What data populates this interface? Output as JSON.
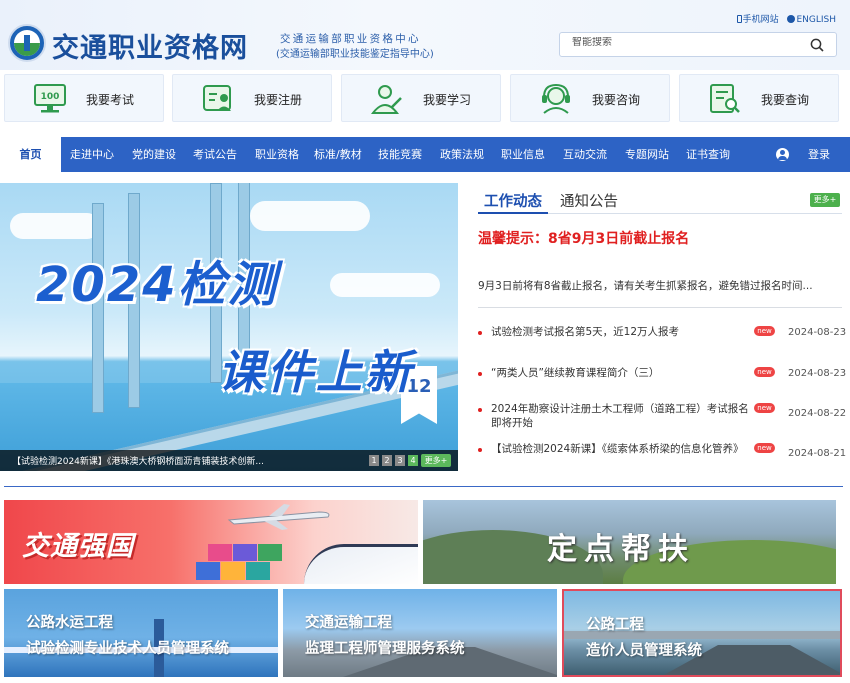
{
  "header": {
    "site_title": "交通职业资格网",
    "org_line1": "交通运输部职业资格中心",
    "org_line2": "(交通运输部职业技能鉴定指导中心)",
    "mobile_link": "手机网站",
    "english_link": "ENGLISH",
    "search_placeholder": "智能搜索"
  },
  "quick_links": [
    {
      "label": "我要考试",
      "icon": "exam-icon"
    },
    {
      "label": "我要注册",
      "icon": "register-icon"
    },
    {
      "label": "我要学习",
      "icon": "study-icon"
    },
    {
      "label": "我要咨询",
      "icon": "consult-icon"
    },
    {
      "label": "我要查询",
      "icon": "query-icon"
    }
  ],
  "quick_icon_badge": "100",
  "nav": {
    "home": "首页",
    "items": [
      "走进中心",
      "党的建设",
      "考试公告",
      "职业资格",
      "标准/教材",
      "技能竞赛",
      "政策法规",
      "职业信息",
      "互动交流",
      "专题网站",
      "证书查询"
    ],
    "login": "登录"
  },
  "banner": {
    "line1": "2024检测",
    "line2": "课件上新",
    "flag_number": "12",
    "caption": "【试验检测2024新课】《港珠澳大桥钢桥面沥青铺装技术创新...",
    "pages": [
      "1",
      "2",
      "3",
      "4"
    ],
    "active_page": "4",
    "more": "更多+"
  },
  "news": {
    "tab_active": "工作动态",
    "tab_inactive": "通知公告",
    "more": "更多+",
    "headline": "温馨提示：8省9月3日前截止报名",
    "summary": "9月3日前将有8省截止报名，请有关考生抓紧报名，避免错过报名时间...",
    "items": [
      {
        "title": "试验检测考试报名第5天，近12万人报考",
        "badge": "new",
        "date": "2024-08-23"
      },
      {
        "title": "“两类人员”继续教育课程简介（三）",
        "badge": "new",
        "date": "2024-08-23"
      },
      {
        "title": "2024年勘察设计注册土木工程师（道路工程）考试报名即将开始",
        "badge": "new",
        "date": "2024-08-22"
      },
      {
        "title": "【试验检测2024新课】《缆索体系桥梁的信息化管养》",
        "badge": "new",
        "date": "2024-08-21"
      }
    ]
  },
  "promos": {
    "left": "交通强国",
    "right": "定点帮扶"
  },
  "systems": [
    {
      "line1": "公路水运工程",
      "line2": "试验检测专业技术人员管理系统"
    },
    {
      "line1": "交通运输工程",
      "line2": "监理工程师管理服务系统"
    },
    {
      "line1": "公路工程",
      "line2": "造价人员管理系统"
    }
  ],
  "colors": {
    "brand_blue": "#2d63c5",
    "headline_red": "#e02020",
    "more_green": "#4cb04c",
    "highlight_border": "#e04b5b"
  }
}
